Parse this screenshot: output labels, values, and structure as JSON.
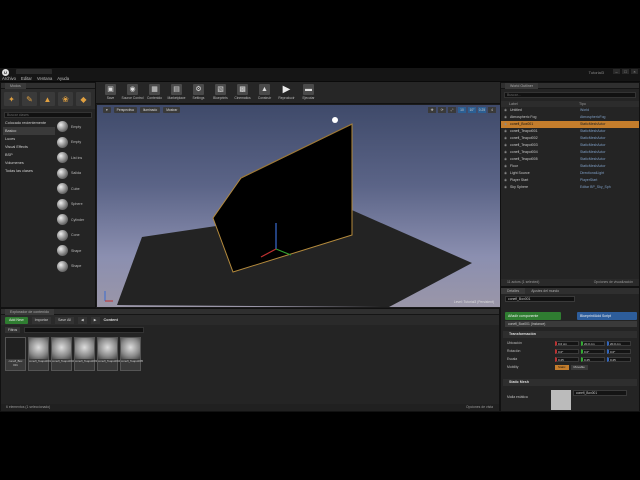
{
  "window": {
    "project_name": "Tutorial3",
    "doc_tab": "untitled"
  },
  "menu": [
    "Archivo",
    "Editar",
    "Ventana",
    "Ayuda"
  ],
  "modes": {
    "tab": "Modos",
    "search_placeholder": "Buscar clases",
    "categories": [
      "Colocado recientemente",
      "Basico",
      "Luces",
      "Visual Effects",
      "BSP",
      "Volumenes",
      "Todas las clases"
    ],
    "items": [
      "Empty",
      "Empty",
      "List ins",
      "Salida",
      "Cube",
      "Sphere",
      "Cylinder",
      "Cone",
      "Shape",
      "Shape"
    ]
  },
  "toolbar": [
    "Save",
    "Source Control",
    "Contenido",
    "Marketplace",
    "Settings",
    "Blueprints",
    "Cinematics",
    "Construir",
    "Reproducir",
    "Ejecutar"
  ],
  "viewport": {
    "buttons": [
      "Perspectiva",
      "Iluminado",
      "Mostrar"
    ],
    "right_buttons": [
      "10",
      "10°",
      "0.25",
      "4"
    ],
    "level_label": "Level: Tutorial3 (Persistent)"
  },
  "outliner": {
    "tab": "World Outliner",
    "search_placeholder": "Buscar...",
    "col_label": "Label",
    "col_type": "Tipo",
    "rows": [
      {
        "name": "Untitled",
        "type": "World",
        "selected": false
      },
      {
        "name": "Atmospheric Fog",
        "type": "AtmosphericFog",
        "selected": false
      },
      {
        "name": "conefl_Box001",
        "type": "StaticMeshActor",
        "selected": true
      },
      {
        "name": "conefl_Teapot001",
        "type": "StaticMeshActor",
        "selected": false
      },
      {
        "name": "conefl_Teapot002",
        "type": "StaticMeshActor",
        "selected": false
      },
      {
        "name": "conefl_Teapot003",
        "type": "StaticMeshActor",
        "selected": false
      },
      {
        "name": "conefl_Teapot004",
        "type": "StaticMeshActor",
        "selected": false
      },
      {
        "name": "conefl_Teapot005",
        "type": "StaticMeshActor",
        "selected": false
      },
      {
        "name": "Floor",
        "type": "StaticMeshActor",
        "selected": false
      },
      {
        "name": "Light Source",
        "type": "DirectionalLight",
        "selected": false
      },
      {
        "name": "Player Start",
        "type": "PlayerStart",
        "selected": false
      },
      {
        "name": "Sky Sphere",
        "type": "Editar BP_Sky_Sph",
        "selected": false
      }
    ],
    "footer_count": "11 actors (1 selected)",
    "footer_options": "Opciones de visualización"
  },
  "details": {
    "tabs": [
      "Detalles",
      "Ajustes del mundo"
    ],
    "name_value": "conefl_Box001",
    "add_component": "Añadir componente",
    "blueprint": "Blueprint/Add Script",
    "component": "conefl_Box001 (Instance)",
    "transform_title": "Transformación",
    "location_label": "Ubicación",
    "rotation_label": "Rotación",
    "scale_label": "Escala",
    "mobility_label": "Mobility",
    "location": [
      "0.0 cm",
      "20.0 cm",
      "20.0 cm"
    ],
    "rotation": [
      "0.0°",
      "0.0°",
      "0.0°"
    ],
    "scale": [
      "0.25",
      "0.25",
      "0.25"
    ],
    "mobility": [
      "Static",
      "Movable"
    ],
    "static_mesh_title": "Static Mesh",
    "static_mesh_label": "Malla estática",
    "static_mesh_value": "conefl_Box001"
  },
  "content": {
    "tab": "Explorador de contenido",
    "add_new": "Add New",
    "import": "Importar",
    "save_all": "Save All",
    "path": "Content",
    "filters": "Filtros",
    "assets": [
      "conefl_Box 001",
      "conefl_Teapot001",
      "conefl_Teapot002",
      "conefl_Teapot003",
      "conefl_Teapot004",
      "conefl_Teapot005"
    ],
    "footer_count": "6 elementos (1 seleccionado)",
    "footer_options": "Opciones de vista"
  }
}
